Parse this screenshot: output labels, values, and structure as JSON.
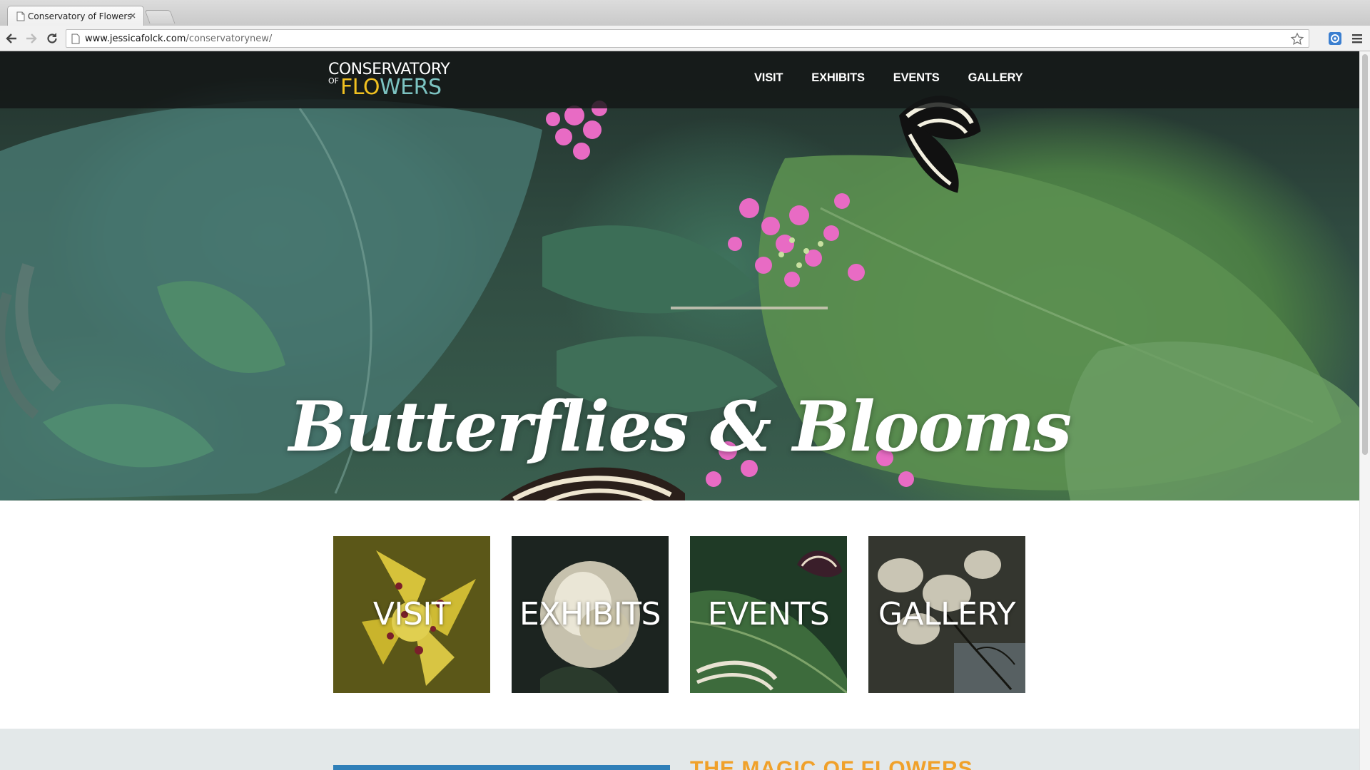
{
  "browser": {
    "tab_title": "Conservatory of Flowers",
    "url_host": "www.jessicafolck.com",
    "url_path": "/conservatorynew/"
  },
  "site": {
    "logo": {
      "line1": "CONSERVATORY",
      "of": "OF",
      "flowers_part1": "FLO",
      "flowers_part2": "WERS"
    },
    "nav": [
      "VISIT",
      "EXHIBITS",
      "EVENTS",
      "GALLERY"
    ],
    "hero_title": "Butterflies & Blooms",
    "tiles": [
      {
        "label": "VISIT",
        "photo": "yellow-orchid"
      },
      {
        "label": "EXHIBITS",
        "photo": "white-gardenia"
      },
      {
        "label": "EVENTS",
        "photo": "zebra-butterfly-on-leaf"
      },
      {
        "label": "GALLERY",
        "photo": "white-orchid"
      }
    ],
    "section_heading": "THE MAGIC OF FLOWERS"
  },
  "colors": {
    "logo_yellow": "#f0c020",
    "logo_teal": "#7cc3c1",
    "band_bar": "#2f7fb8",
    "section_heading": "#f0a12a"
  }
}
